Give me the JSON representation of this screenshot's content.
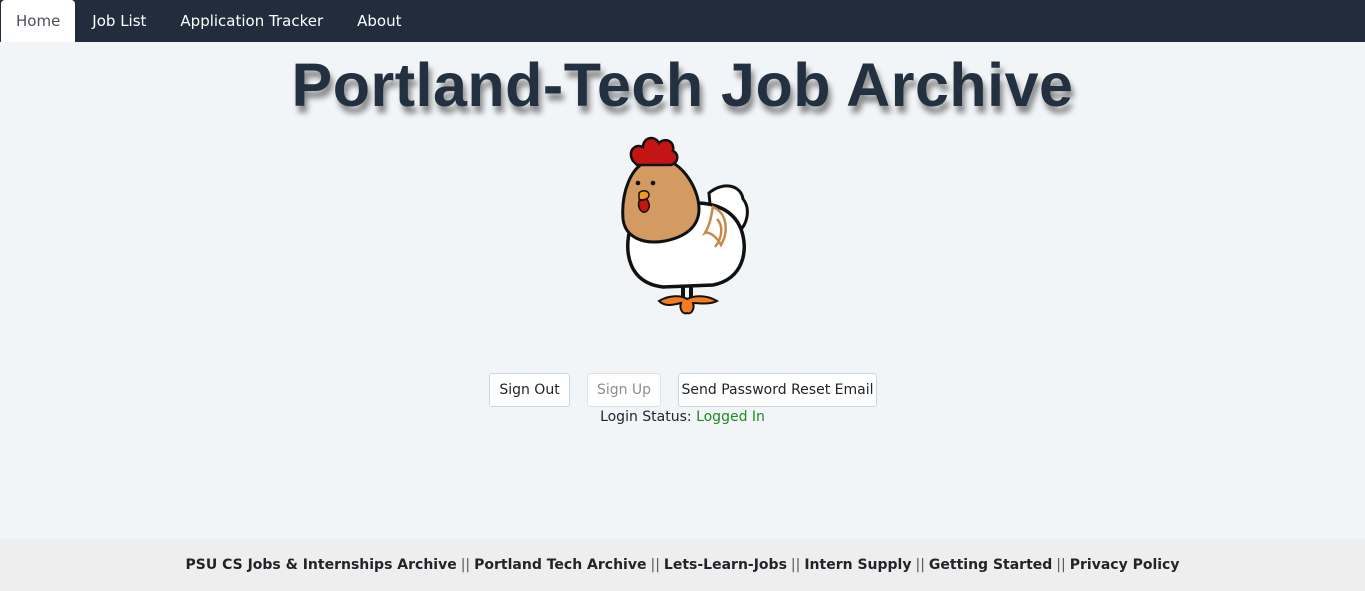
{
  "nav": {
    "tabs": [
      {
        "label": "Home",
        "active": true
      },
      {
        "label": "Job List"
      },
      {
        "label": "Application Tracker"
      },
      {
        "label": "About"
      }
    ]
  },
  "page_title": "Portland-Tech Job Archive",
  "mascot_icon": "chicken-icon",
  "auth": {
    "sign_out_label": "Sign Out",
    "sign_up_label": "Sign Up",
    "reset_label": "Send Password Reset Email",
    "status_label": "Login Status:",
    "status_value": "Logged In"
  },
  "footer": {
    "links": [
      "PSU CS Jobs & Internships Archive",
      "Portland Tech Archive",
      "Lets-Learn-Jobs",
      "Intern Supply",
      "Getting Started",
      "Privacy Policy"
    ],
    "separator": "||"
  },
  "colors": {
    "navbar": "#212d3c",
    "status_ok": "#1f8a1f"
  }
}
